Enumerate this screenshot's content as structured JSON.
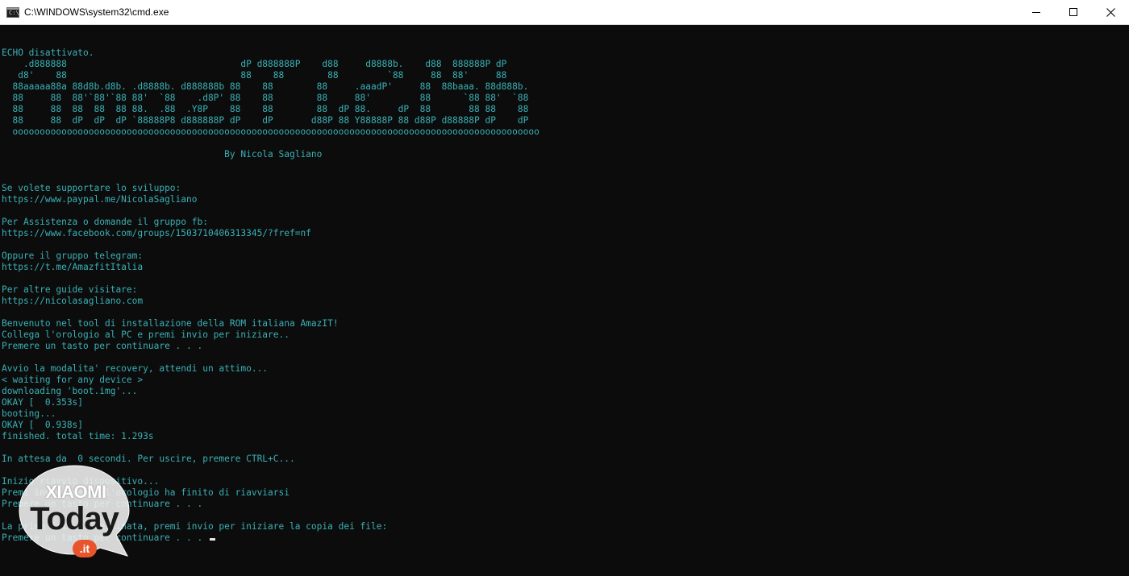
{
  "window": {
    "title": "C:\\WINDOWS\\system32\\cmd.exe",
    "icon": "cmd-icon",
    "icon_glyph": "C:\\",
    "controls": [
      "minimize-icon",
      "maximize-icon",
      "close-icon"
    ]
  },
  "console": {
    "text_color": "#3ab0b5",
    "background": "#0c0c0c",
    "lines": [
      "ECHO disattivato.",
      "    .d888888                                dP d888888P    d88     d8888b.    d88  888888P dP",
      "   d8'    88                                88    88        88         `88     88  88'     88",
      "  88aaaaa88a 88d8b.d8b. .d8888b. d888888b 88    88        88     .aaadP'     88  88baaa. 88d888b.",
      "  88     88  88'`88'`88 88'  `88    .d8P' 88    88        88     88'         88      `88 88'  `88",
      "  88     88  88  88  88 88.  .88  .Y8P    88    88        88  dP 88.     dP  88       88 88    88",
      "  88     88  dP  dP  dP `88888P8 d888888P dP    dP       d88P 88 Y88888P 88 d88P d88888P dP    dP",
      "  ooooooooooooooooooooooooooooooooooooooooooooooooooooooooooooooooooooooooooooooooooooooooooooooooo",
      "",
      "                                         By Nicola Sagliano",
      "",
      "",
      "Se volete supportare lo sviluppo:",
      "https://www.paypal.me/NicolaSagliano",
      "",
      "Per Assistenza o domande il gruppo fb:",
      "https://www.facebook.com/groups/1503710406313345/?fref=nf",
      "",
      "Oppure il gruppo telegram:",
      "https://t.me/AmazfitItalia",
      "",
      "Per altre guide visitare:",
      "https://nicolasagliano.com",
      "",
      "Benvenuto nel tool di installazione della ROM italiana AmazIT!",
      "Collega l'orologio al PC e premi invio per iniziare..",
      "Premere un tasto per continuare . . .",
      "",
      "Avvio la modalita' recovery, attendi un attimo...",
      "< waiting for any device >",
      "downloading 'boot.img'...",
      "OKAY [  0.353s]",
      "booting...",
      "OKAY [  0.938s]",
      "finished. total time: 1.293s",
      "",
      "In attesa da  0 secondi. Per uscire, premere CTRL+C...",
      "",
      "Inizio riavvio dispositivo...",
      "Premi invio quando l'orologio ha finito di riavviarsi",
      "Premere un tasto per continuare . . .",
      "",
      "La prima fase e' terminata, premi invio per iniziare la copia dei file:",
      "Premere un tasto per continuare . . . "
    ]
  },
  "watermark": {
    "brand_top": "XIAOMI",
    "brand_main": "Today",
    "brand_tld": ".it",
    "bubble_color": "#f2f2f2",
    "accent_color": "#e8552c"
  }
}
